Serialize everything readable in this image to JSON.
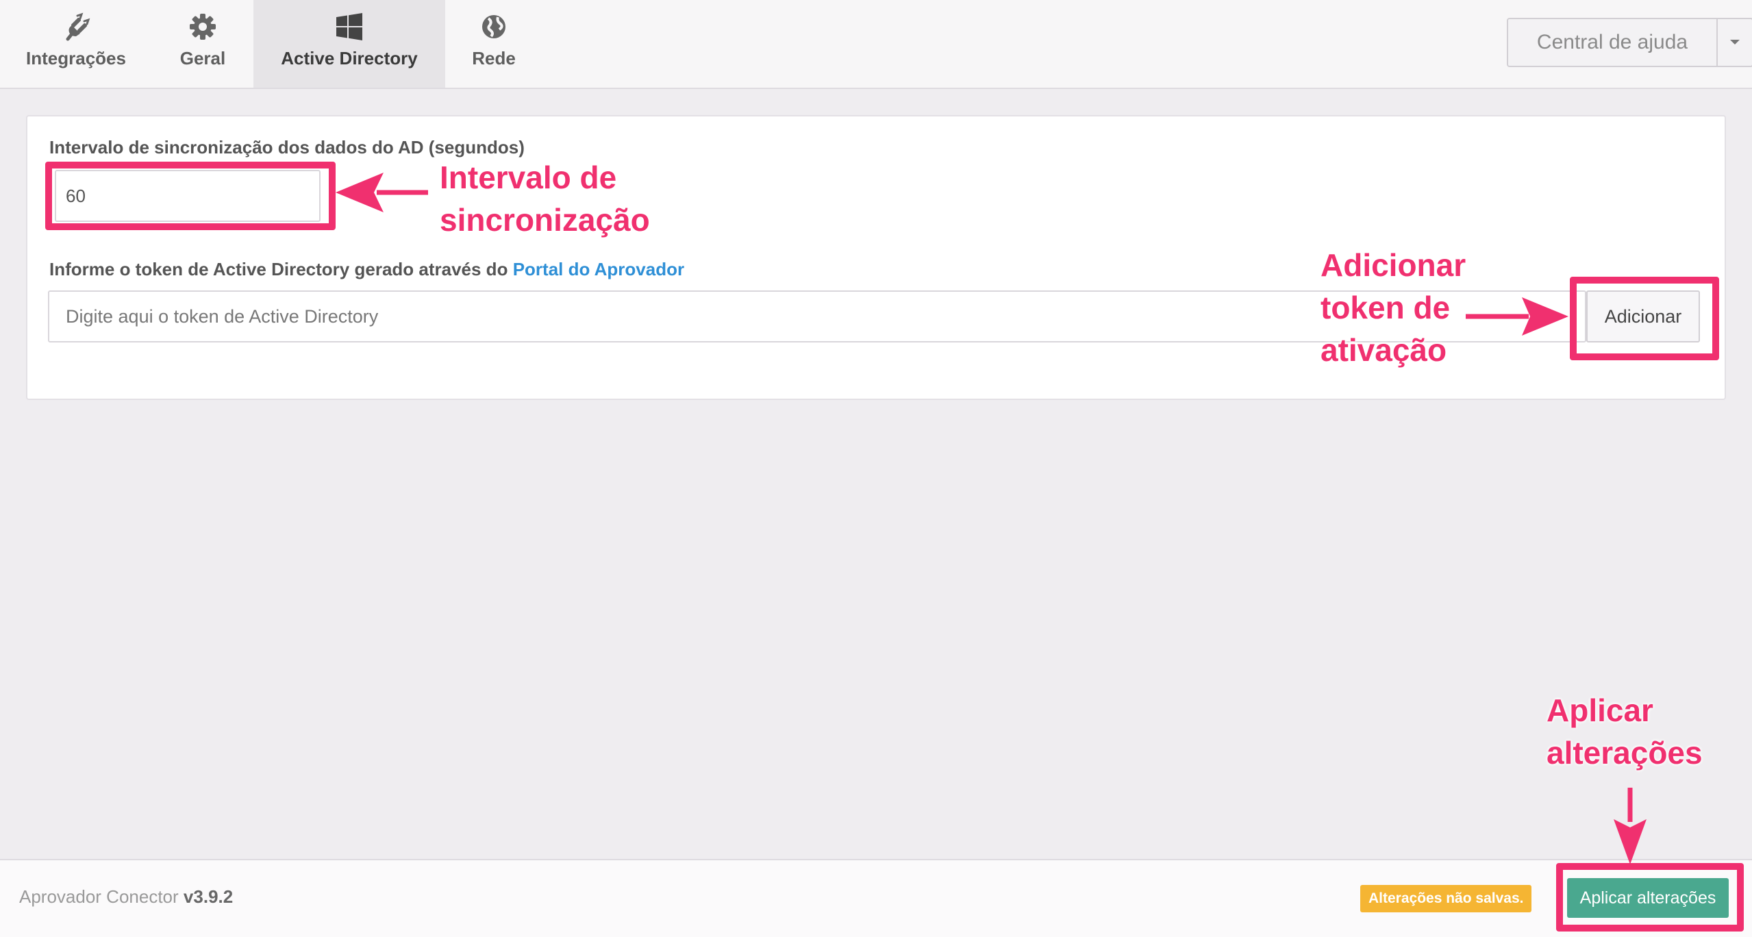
{
  "tabs": [
    {
      "label": "Integrações",
      "icon": "plug-icon"
    },
    {
      "label": "Geral",
      "icon": "gear-icon"
    },
    {
      "label": "Active Directory",
      "icon": "windows-icon",
      "active": true
    },
    {
      "label": "Rede",
      "icon": "globe-icon"
    }
  ],
  "help": {
    "label": "Central de ajuda"
  },
  "form": {
    "interval_label": "Intervalo de sincronização dos dados do AD (segundos)",
    "interval_value": "60",
    "token_label_prefix": "Informe o token de Active Directory gerado através do",
    "token_label_link": "Portal do Aprovador",
    "token_placeholder": "Digite aqui o token de Active Directory",
    "add_button": "Adicionar"
  },
  "footer": {
    "app_name": "Aprovador Conector",
    "version": "v3.9.2",
    "unsaved_badge": "Alterações não salvas.",
    "apply_button": "Aplicar alterações"
  },
  "annotations": {
    "interval_line1": "Intervalo de",
    "interval_line2": "sincronização",
    "token_line1": "Adicionar",
    "token_line2": "token de",
    "token_line3": "ativação",
    "apply_line1": "Aplicar",
    "apply_line2": "alterações"
  },
  "colors": {
    "annotation": "#f0306f",
    "apply_button": "#4aa88f",
    "unsaved_badge": "#f5b533",
    "link": "#2e8fd6"
  }
}
